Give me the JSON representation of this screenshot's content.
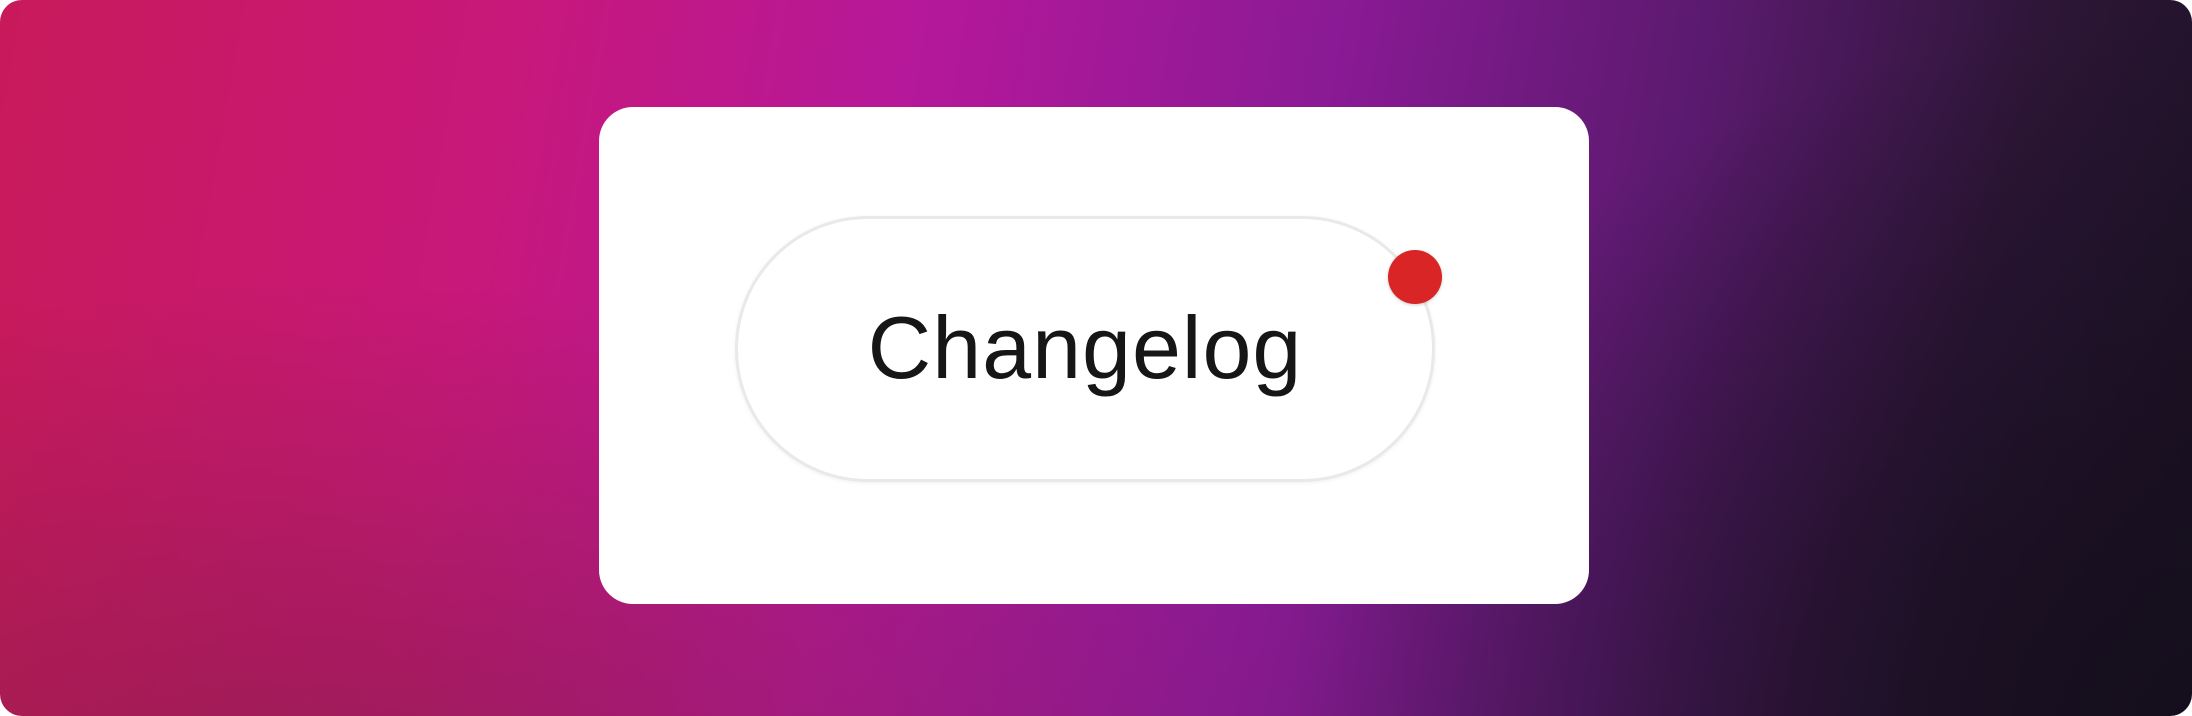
{
  "changelog_button": {
    "label": "Changelog",
    "has_unread_indicator": true
  },
  "colors": {
    "card_background": "#ffffff",
    "indicator": "#d92525",
    "gradient_stops": [
      "#c81a5a",
      "#c8187a",
      "#b5189a",
      "#8a1a95",
      "#5a1a6e",
      "#2e1638",
      "#1c1224"
    ]
  }
}
